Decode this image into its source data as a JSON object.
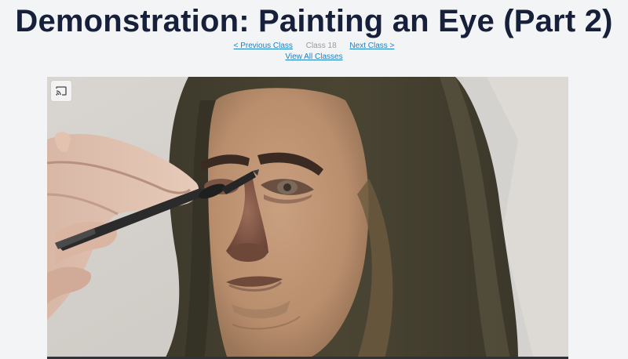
{
  "page": {
    "title": "Demonstration: Painting an Eye (Part 2)"
  },
  "nav": {
    "previous_label": "< Previous Class",
    "current_label": "Class 18",
    "next_label": "Next Class >",
    "all_label": "View All Classes"
  },
  "video": {
    "cast_icon": "cast-icon"
  },
  "colors": {
    "title": "#16203a",
    "link": "#1b7fc4",
    "background": "#f3f4f6"
  }
}
